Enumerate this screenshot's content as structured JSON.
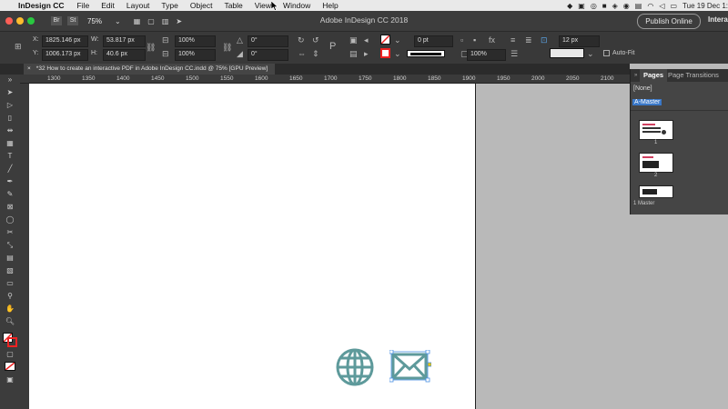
{
  "menubar": {
    "app_name": "InDesign CC",
    "menus": [
      "File",
      "Edit",
      "Layout",
      "Type",
      "Object",
      "Table",
      "View",
      "Window",
      "Help"
    ],
    "clock": "Tue 19 Dec 1:"
  },
  "titlebar": {
    "br_label": "Br",
    "st_label": "St",
    "zoom": "75%",
    "window_title": "Adobe InDesign CC 2018",
    "publish_label": "Publish Online",
    "workspace_label": "Intera"
  },
  "control": {
    "x_label": "X:",
    "x_value": "1825.146 px",
    "y_label": "Y:",
    "y_value": "1006.173 px",
    "w_label": "W:",
    "w_value": "53.817 px",
    "h_label": "H:",
    "h_value": "40.6 px",
    "scale_x": "100%",
    "scale_y": "100%",
    "rotate": "0°",
    "shear": "0°",
    "stroke_weight": "0 pt",
    "opacity": "100%",
    "gap": "12 px",
    "auto_fit_label": "Auto-Fit"
  },
  "tab": {
    "label": "*32 How to create an interactive PDF in Adobe InDesign CC.indd @ 75% [GPU Preview]"
  },
  "ruler": {
    "ticks": [
      "1300",
      "1350",
      "1400",
      "1450",
      "1500",
      "1550",
      "1600",
      "1650",
      "1700",
      "1750",
      "1800",
      "1850",
      "1900",
      "1950",
      "2000",
      "2050",
      "2100"
    ]
  },
  "pages_panel": {
    "tab_pages": "Pages",
    "tab_transitions": "Page Transitions",
    "none_label": "[None]",
    "master_label": "A-Master",
    "page1": "1",
    "page2": "2",
    "footer": "1 Master"
  },
  "colors": {
    "icon_teal": "#5e9a9b",
    "selection_blue": "#4a90e2"
  }
}
